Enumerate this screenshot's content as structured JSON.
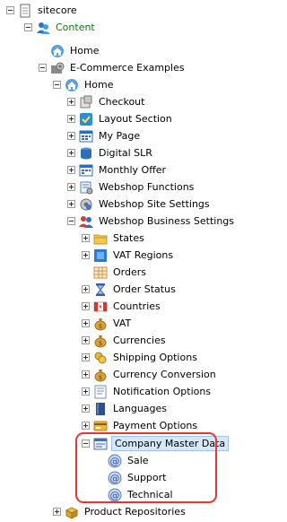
{
  "tree": {
    "root": {
      "label": "sitecore",
      "icon": "sitecore-doc-icon"
    },
    "content": {
      "label": "Content",
      "icon": "content-users-icon",
      "color": "#0a7a0a"
    },
    "home_top": {
      "label": "Home",
      "icon": "home-icon"
    },
    "ecommerce": {
      "label": "E-Commerce Examples",
      "icon": "gear-folder-icon"
    },
    "home": {
      "label": "Home",
      "icon": "home-icon"
    },
    "items": [
      {
        "label": "Checkout",
        "icon": "checkout-icon"
      },
      {
        "label": "Layout Section",
        "icon": "layout-section-icon"
      },
      {
        "label": "My Page",
        "icon": "my-page-icon"
      },
      {
        "label": "Digital SLR",
        "icon": "digital-slr-icon"
      },
      {
        "label": "Monthly Offer",
        "icon": "monthly-offer-icon"
      },
      {
        "label": "Webshop Functions",
        "icon": "webshop-functions-icon"
      },
      {
        "label": "Webshop Site Settings",
        "icon": "site-settings-icon"
      },
      {
        "label": "Webshop Business Settings",
        "icon": "business-settings-icon"
      }
    ],
    "business_children": [
      {
        "label": "States",
        "icon": "folder-icon"
      },
      {
        "label": "VAT Regions",
        "icon": "vat-regions-icon"
      },
      {
        "label": "Orders",
        "icon": "orders-icon"
      },
      {
        "label": "Order Status",
        "icon": "hourglass-icon"
      },
      {
        "label": "Countries",
        "icon": "flag-icon"
      },
      {
        "label": "VAT",
        "icon": "money-bag-icon"
      },
      {
        "label": "Currencies",
        "icon": "money-bag-icon"
      },
      {
        "label": "Shipping Options",
        "icon": "shipping-icon"
      },
      {
        "label": "Currency Conversion",
        "icon": "money-bag-icon"
      },
      {
        "label": "Notification Options",
        "icon": "notification-icon"
      },
      {
        "label": "Languages",
        "icon": "book-icon"
      },
      {
        "label": "Payment Options",
        "icon": "payment-icon"
      }
    ],
    "company_master": {
      "label": "Company Master Data",
      "icon": "company-data-icon"
    },
    "company_children": [
      {
        "label": "Sale",
        "icon": "email-at-icon"
      },
      {
        "label": "Support",
        "icon": "email-at-icon"
      },
      {
        "label": "Technical",
        "icon": "email-at-icon"
      }
    ],
    "product_repos": {
      "label": "Product Repositories",
      "icon": "product-repo-icon"
    },
    "highlight_color": "#e8352d"
  }
}
